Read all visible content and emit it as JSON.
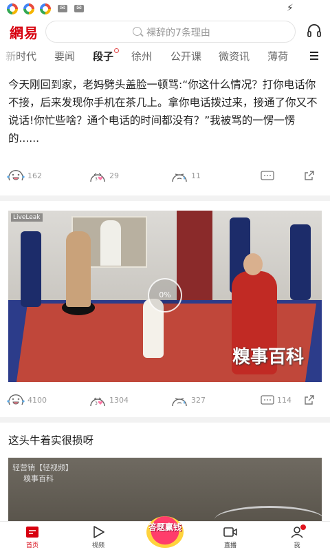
{
  "header": {
    "logo": "網易",
    "search_placeholder": "裸辞的7条理由"
  },
  "tabs": [
    {
      "label": "新时代"
    },
    {
      "label": "要闻"
    },
    {
      "label": "段子"
    },
    {
      "label": "徐州"
    },
    {
      "label": "公开课"
    },
    {
      "label": "微资讯"
    },
    {
      "label": "薄荷"
    }
  ],
  "posts": [
    {
      "text": "今天刚回到家，老妈劈头盖脸一顿骂:“你这什么情况？打你电话你不接，后来发现你手机在茶几上。拿你电话拨过来，接通了你又不说话!你忙些啥？通个电话的时间都没有？”我被骂的一愣一愣的......",
      "laugh": "162",
      "cute": "29",
      "sad": "11",
      "comments": "",
      "share": ""
    },
    {
      "video_source": "LiveLeak",
      "video_progress": "0%",
      "video_watermark": "糗事百科",
      "laugh": "4100",
      "cute": "1304",
      "sad": "327",
      "comments": "114"
    },
    {
      "title": "这头牛着实很损呀",
      "video_label": "轻营销【轻视频】",
      "video_watermark": "糗事百科"
    }
  ],
  "bottom_nav": {
    "home": "首页",
    "video": "视频",
    "promo": "答题赢钱",
    "live": "直播",
    "me": "我"
  },
  "colors": {
    "brand_red": "#d7000f",
    "accent_pink": "#ff3d6b"
  }
}
